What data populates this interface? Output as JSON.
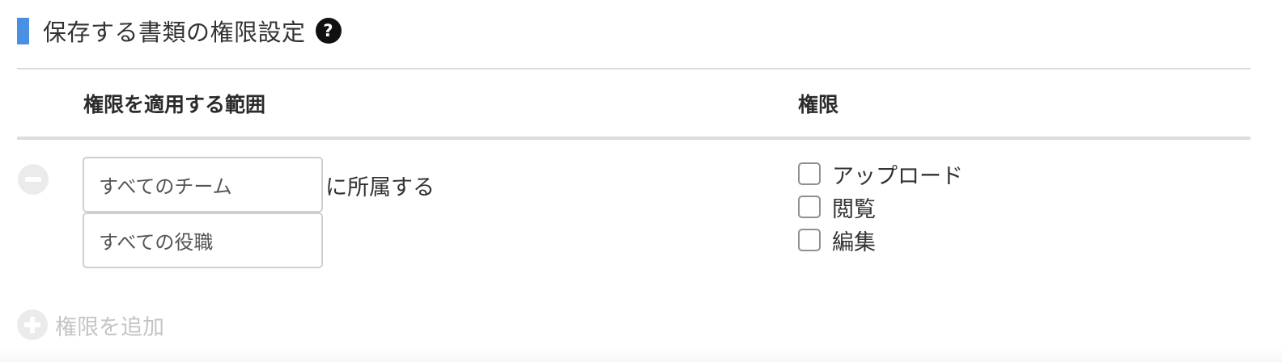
{
  "section": {
    "title": "保存する書類の権限設定",
    "help_icon_glyph": "?",
    "accent_color": "#4a90e2"
  },
  "table": {
    "headers": {
      "scope": "権限を適用する範囲",
      "permission": "権限"
    },
    "row": {
      "team_select_value": "すべてのチーム",
      "role_select_value": "すべての役職",
      "belongs_text": "に所属する",
      "permissions": [
        {
          "label": "アップロード",
          "checked": false
        },
        {
          "label": "閲覧",
          "checked": false
        },
        {
          "label": "編集",
          "checked": false
        }
      ]
    }
  },
  "add_permission_label": "権限を追加",
  "icons": {
    "help": "question-circle-icon",
    "remove": "minus-circle-icon",
    "add": "plus-circle-icon"
  }
}
